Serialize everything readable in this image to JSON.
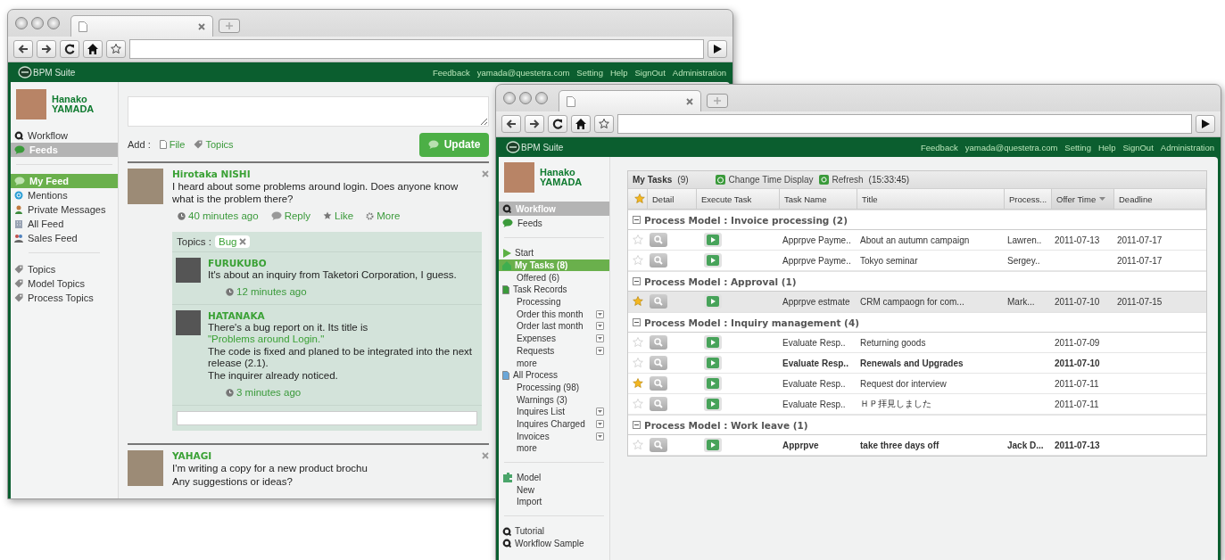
{
  "feed_window": {
    "header": {
      "logo": "BPM Suite",
      "links": [
        "Feedback",
        "yamada@questetra.com",
        "Setting",
        "Help",
        "SignOut",
        "Administration"
      ]
    },
    "user": {
      "name": "Hanako YAMADA"
    },
    "nav": [
      {
        "label": "Workflow",
        "selected": false
      },
      {
        "label": "Feeds",
        "selected": true
      }
    ],
    "feed_menu": [
      {
        "label": "My Feed",
        "selected": true
      },
      {
        "label": "Mentions",
        "selected": false
      },
      {
        "label": "Private Messages",
        "selected": false
      },
      {
        "label": "All Feed",
        "selected": false
      },
      {
        "label": "Sales Feed",
        "selected": false
      }
    ],
    "topic_menu": [
      {
        "label": "Topics",
        "selected": false
      },
      {
        "label": "Model Topics",
        "selected": false
      },
      {
        "label": "Process Topics",
        "selected": false
      }
    ],
    "composer": {
      "add_label": "Add :",
      "attachments": [
        "File",
        "Topics"
      ],
      "update_button": "Update"
    },
    "posts": [
      {
        "author": "Hirotaka NISHI",
        "lines": [
          "I heard about some problems around login. Does anyone know what is the problem there?"
        ],
        "time": "40 minutes ago",
        "actions": [
          "Reply",
          "Like",
          "More"
        ],
        "topics_label": "Topics :",
        "topics": [
          "Bug"
        ],
        "replies": [
          {
            "author": "FURUKUBO",
            "text": "It's about an inquiry from Taketori Corporation, I guess.",
            "time": "12 minutes ago"
          },
          {
            "author": "HATANAKA",
            "text": "There's a bug report on it. Its title is ",
            "link": "\"Problems around Login.\"",
            "lines": [
              "The code is fixed and planed to be integrated into the next release (2.1).",
              "The inquirer already noticed."
            ],
            "time": "3 minutes ago"
          }
        ]
      },
      {
        "author": "YAHAGI",
        "lines": [
          "I'm writing a copy for a new product brochu",
          "Any suggestions or ideas?"
        ]
      }
    ]
  },
  "tasks_window": {
    "header": {
      "logo": "BPM Suite",
      "links": [
        "Feedback",
        "yamada@questetra.com",
        "Setting",
        "Help",
        "SignOut",
        "Administration"
      ]
    },
    "user": {
      "name": "Hanako YAMADA"
    },
    "nav": [
      {
        "label": "Workflow",
        "selected": true
      },
      {
        "label": "Feeds",
        "selected": false
      }
    ],
    "menu_groups": [
      [
        {
          "label": "Start",
          "kind": "head",
          "selected": false
        },
        {
          "label": "My Tasks (8)",
          "kind": "head",
          "selected": true
        },
        {
          "label": "Offered (6)",
          "kind": "sub",
          "selected": false
        },
        {
          "label": "Task Records",
          "kind": "head",
          "selected": false
        },
        {
          "label": "Processing",
          "kind": "sub",
          "selected": false
        },
        {
          "label": "Order this month",
          "kind": "sub",
          "selected": false,
          "menu": true
        },
        {
          "label": "Order last month",
          "kind": "sub",
          "selected": false,
          "menu": true
        },
        {
          "label": "Expenses",
          "kind": "sub",
          "selected": false,
          "menu": true
        },
        {
          "label": "Requests",
          "kind": "sub",
          "selected": false,
          "menu": true
        },
        {
          "label": "more",
          "kind": "sub",
          "selected": false
        },
        {
          "label": "All Process",
          "kind": "head",
          "selected": false
        },
        {
          "label": "Processing (98)",
          "kind": "sub",
          "selected": false
        },
        {
          "label": "Warnings (3)",
          "kind": "sub",
          "selected": false
        },
        {
          "label": "Inquires List",
          "kind": "sub",
          "selected": false,
          "menu": true
        },
        {
          "label": "Inquires Charged",
          "kind": "sub",
          "selected": false,
          "menu": true
        },
        {
          "label": "Invoices",
          "kind": "sub",
          "selected": false,
          "menu": true
        },
        {
          "label": "more",
          "kind": "sub",
          "selected": false
        }
      ],
      [
        {
          "label": "Model",
          "kind": "head",
          "selected": false
        },
        {
          "label": "New",
          "kind": "sub",
          "selected": false
        },
        {
          "label": "Import",
          "kind": "sub",
          "selected": false
        }
      ],
      [
        {
          "label": "Tutorial",
          "kind": "head",
          "selected": false
        },
        {
          "label": "Workflow Sample",
          "kind": "head",
          "selected": false
        }
      ]
    ],
    "tasks": {
      "title": "My Tasks",
      "count": "(9)",
      "actions": [
        "Change Time Display",
        "Refresh"
      ],
      "time": "(15:33:45)",
      "columns": [
        {
          "label": "Detail",
          "sorted": false
        },
        {
          "label": "Execute Task",
          "sorted": false
        },
        {
          "label": "Task Name",
          "sorted": false
        },
        {
          "label": "Title",
          "sorted": false
        },
        {
          "label": "Process...",
          "sorted": false
        },
        {
          "label": "Offer Time",
          "sorted": true
        },
        {
          "label": "Deadline",
          "sorted": false
        }
      ],
      "groups": [
        {
          "title": "Process Model : Invoice processing (2)",
          "expanded": true,
          "rows": [
            {
              "starred": false,
              "unread": false,
              "selected": false,
              "task": "Apprpve Payme..",
              "title": "About an autumn campaign",
              "process": "Lawren..",
              "offer_time": "2011-07-13",
              "deadline": "2011-07-17"
            },
            {
              "starred": false,
              "unread": false,
              "selected": false,
              "task": "Apprpve Payme..",
              "title": "Tokyo seminar",
              "process": "Sergey..",
              "deadline": "2011-07-17"
            }
          ]
        },
        {
          "title": "Process Model : Approval (1)",
          "expanded": true,
          "rows": [
            {
              "starred": true,
              "unread": false,
              "selected": true,
              "task": "Apprpve estmate",
              "title": "CRM campaogn for com...",
              "process": "Mark...",
              "offer_time": "2011-07-10",
              "deadline": "2011-07-15"
            }
          ]
        },
        {
          "title": "Process Model : Inquiry management (4)",
          "expanded": true,
          "rows": [
            {
              "starred": false,
              "unread": false,
              "selected": false,
              "task": "Evaluate Resp..",
              "title": "Returning goods",
              "offer_time": "2011-07-09"
            },
            {
              "starred": false,
              "unread": true,
              "selected": false,
              "task": "Evaluate Resp..",
              "title": "Renewals and Upgrades",
              "offer_time": "2011-07-10"
            },
            {
              "starred": true,
              "unread": false,
              "selected": false,
              "task": "Evaluate Resp..",
              "title": "Request dor interview",
              "offer_time": "2011-07-11"
            },
            {
              "starred": false,
              "unread": false,
              "selected": false,
              "task": "Evaluate Resp..",
              "title": "ＨＰ拝見しました",
              "offer_time": "2011-07-11"
            }
          ]
        },
        {
          "title": "Process Model : Work leave (1)",
          "expanded": true,
          "rows": [
            {
              "starred": false,
              "unread": true,
              "selected": false,
              "task": "Apprpve",
              "title": "take three days off",
              "process": "Jack D...",
              "offer_time": "2011-07-13"
            }
          ]
        }
      ]
    }
  }
}
